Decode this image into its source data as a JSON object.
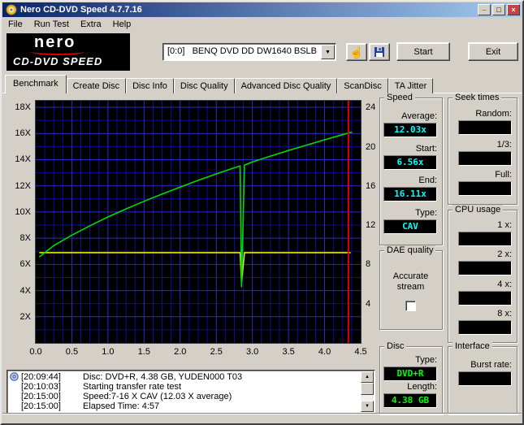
{
  "window": {
    "title": "Nero CD-DVD Speed 4.7.7.16",
    "controls": {
      "minimize": "_",
      "maximize": "□",
      "close": "×"
    }
  },
  "menu": {
    "items": [
      "File",
      "Run Test",
      "Extra",
      "Help"
    ]
  },
  "toolbar": {
    "logo_line1": "nero",
    "logo_line2": "CD-DVD SPEED",
    "drive": "[0:0]   BENQ DVD DD DW1640 BSLB",
    "start_label": "Start",
    "exit_label": "Exit"
  },
  "tabs": [
    "Benchmark",
    "Create Disc",
    "Disc Info",
    "Disc Quality",
    "Advanced Disc Quality",
    "ScanDisc",
    "TA Jitter"
  ],
  "panels": {
    "speed": {
      "title": "Speed",
      "lcd": "cyan",
      "fields": [
        {
          "label": "Average:",
          "value": "12.03x"
        },
        {
          "label": "Start:",
          "value": "6.56x"
        },
        {
          "label": "End:",
          "value": "16.11x"
        },
        {
          "label": "Type:",
          "value": "CAV"
        }
      ]
    },
    "seek_times": {
      "title": "Seek times",
      "lcd": "cyan",
      "fields": [
        {
          "label": "Random:",
          "value": ""
        },
        {
          "label": "1/3:",
          "value": ""
        },
        {
          "label": "Full:",
          "value": ""
        }
      ]
    },
    "cpu_usage": {
      "title": "CPU usage",
      "lcd": "cyan",
      "fields": [
        {
          "label": "1 x:",
          "value": ""
        },
        {
          "label": "2 x:",
          "value": ""
        },
        {
          "label": "4 x:",
          "value": ""
        },
        {
          "label": "8 x:",
          "value": ""
        }
      ]
    },
    "dae_quality": {
      "title": "DAE quality",
      "checkbox_label": "Accurate stream",
      "checked": false
    },
    "disc": {
      "title": "Disc",
      "lcd": "green",
      "fields": [
        {
          "label": "Type:",
          "value": "DVD+R"
        },
        {
          "label": "Length:",
          "value": "4.38 GB"
        }
      ]
    },
    "interface": {
      "title": "Interface",
      "lcd": "cyan",
      "fields": [
        {
          "label": "Burst rate:",
          "value": ""
        }
      ]
    }
  },
  "log": {
    "lines": [
      {
        "time": "[20:09:44]",
        "text": "Disc: DVD+R, 4.38 GB, YUDEN000 T03",
        "icon": true
      },
      {
        "time": "[20:10:03]",
        "text": "Starting transfer rate test",
        "icon": false
      },
      {
        "time": "[20:15:00]",
        "text": "Speed:7-16 X CAV (12.03 X average)",
        "icon": false
      },
      {
        "time": "[20:15:00]",
        "text": "Elapsed Time:  4:57",
        "icon": false
      }
    ]
  },
  "colors": {
    "lcd_cyan": "#00ffff",
    "lcd_green": "#00ff00",
    "chart_bg": "#000000",
    "grid_minor": "#0d0d9d",
    "grid_major": "#2a2ad0",
    "transfer_line": "#00dc00",
    "rotation_line": "#ecec00",
    "end_marker": "#dd0000",
    "titlebar_left": "#0a246a",
    "titlebar_right": "#a6caf0"
  },
  "chart_data": {
    "type": "line",
    "x_axis": {
      "min": 0,
      "max": 4.5,
      "ticks": [
        {
          "v": 0,
          "t": "0.0"
        },
        {
          "v": 0.5,
          "t": "0.5"
        },
        {
          "v": 1,
          "t": "1.0"
        },
        {
          "v": 1.5,
          "t": "1.5"
        },
        {
          "v": 2,
          "t": "2.0"
        },
        {
          "v": 2.5,
          "t": "2.5"
        },
        {
          "v": 3,
          "t": "3.0"
        },
        {
          "v": 3.5,
          "t": "3.5"
        },
        {
          "v": 4,
          "t": "4.0"
        },
        {
          "v": 4.5,
          "t": "4.5"
        }
      ]
    },
    "y_left": {
      "min": 0,
      "max": 18.5,
      "ticks": [
        {
          "v": 2,
          "t": "2X"
        },
        {
          "v": 4,
          "t": "4X"
        },
        {
          "v": 6,
          "t": "6X"
        },
        {
          "v": 8,
          "t": "8X"
        },
        {
          "v": 10,
          "t": "10X"
        },
        {
          "v": 12,
          "t": "12X"
        },
        {
          "v": 14,
          "t": "14X"
        },
        {
          "v": 16,
          "t": "16X"
        },
        {
          "v": 18,
          "t": "18X"
        }
      ]
    },
    "y_right": {
      "min": 0,
      "max": 24.7,
      "ticks": [
        {
          "v": 4,
          "t": "4"
        },
        {
          "v": 8,
          "t": "8"
        },
        {
          "v": 12,
          "t": "12"
        },
        {
          "v": 16,
          "t": "16"
        },
        {
          "v": 20,
          "t": "20"
        },
        {
          "v": 24,
          "t": "24"
        }
      ]
    },
    "grid": {
      "minor_x": 0.125,
      "major_x": 0.5,
      "minor_y": 1,
      "major_y": 2
    },
    "series": [
      {
        "name": "rotation-speed",
        "color": "#ecec00",
        "points": [
          [
            0.05,
            6.9
          ],
          [
            2.83,
            6.9
          ],
          [
            2.85,
            4.6
          ],
          [
            2.89,
            6.9
          ],
          [
            4.36,
            6.9
          ]
        ]
      },
      {
        "name": "transfer-rate",
        "color": "#00dc00",
        "points": [
          [
            0.05,
            6.56
          ],
          [
            0.25,
            7.44
          ],
          [
            0.5,
            8.23
          ],
          [
            0.75,
            8.95
          ],
          [
            1.0,
            9.62
          ],
          [
            1.25,
            10.24
          ],
          [
            1.5,
            10.82
          ],
          [
            1.75,
            11.38
          ],
          [
            2.0,
            11.91
          ],
          [
            2.25,
            12.42
          ],
          [
            2.5,
            12.91
          ],
          [
            2.75,
            13.38
          ],
          [
            2.83,
            13.52
          ],
          [
            2.85,
            4.3
          ],
          [
            2.89,
            13.58
          ],
          [
            3.0,
            13.83
          ],
          [
            3.25,
            14.27
          ],
          [
            3.5,
            14.7
          ],
          [
            3.75,
            15.11
          ],
          [
            4.0,
            15.52
          ],
          [
            4.25,
            15.91
          ],
          [
            4.38,
            16.11
          ]
        ]
      }
    ],
    "markers": [
      {
        "type": "vline",
        "x": 4.33,
        "color": "#dd0000"
      }
    ]
  }
}
